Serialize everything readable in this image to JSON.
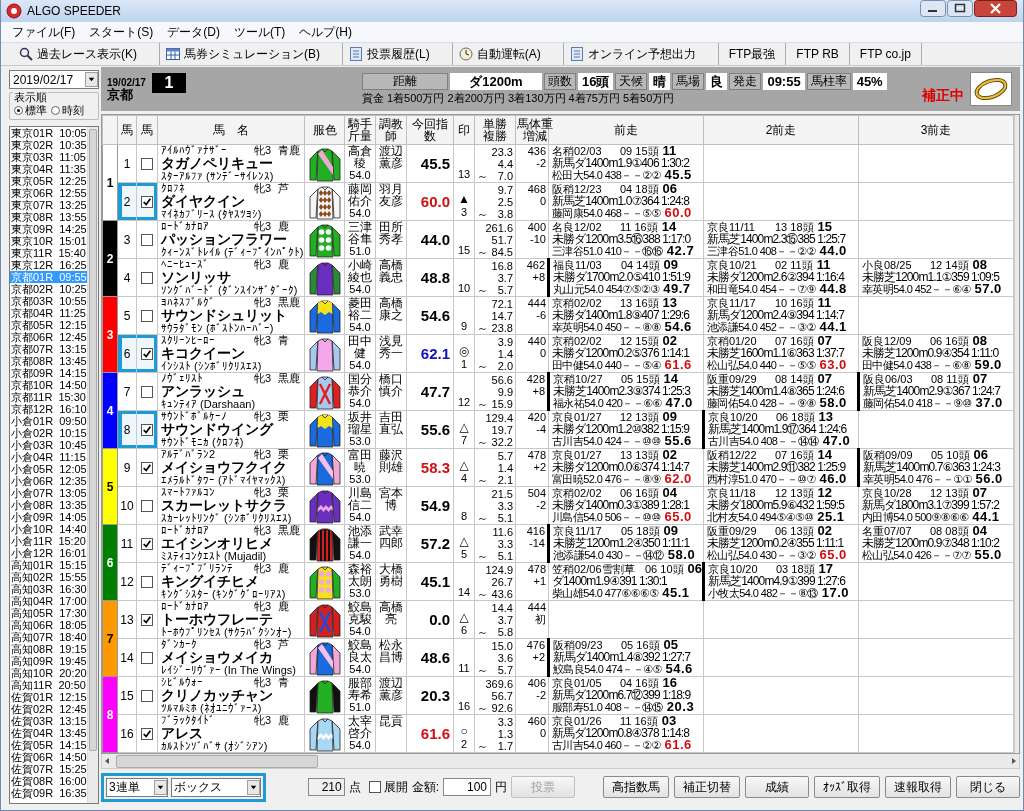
{
  "window": {
    "title": "ALGO SPEEDER"
  },
  "menu": [
    "ファイル(F)",
    "スタート(S)",
    "データ(D)",
    "ツール(T)",
    "ヘルプ(H)"
  ],
  "toolbar": [
    {
      "label": "過去レース表示(K)",
      "kind": "search"
    },
    {
      "label": "馬券シミュレーション(B)",
      "kind": "table"
    },
    {
      "label": "投票履歴(L)",
      "kind": "document"
    },
    {
      "label": "自動運転(A)",
      "kind": "clock"
    },
    {
      "label": "オンライン予想出力",
      "kind": "document"
    },
    {
      "label": "FTP最強",
      "kind": "text"
    },
    {
      "label": "FTP RB",
      "kind": "text"
    },
    {
      "label": "FTP co.jp",
      "kind": "text"
    }
  ],
  "sidebar": {
    "date": "2019/02/17",
    "sort_label": "表示順",
    "sort_options": [
      {
        "label": "標準",
        "selected": true
      },
      {
        "label": "時刻",
        "selected": false
      }
    ],
    "races": [
      {
        "race": "東京01R",
        "time": "10:05",
        "selected": false
      },
      {
        "race": "東京02R",
        "time": "10:35",
        "selected": false
      },
      {
        "race": "東京03R",
        "time": "11:05",
        "selected": false
      },
      {
        "race": "東京04R",
        "time": "11:35",
        "selected": false
      },
      {
        "race": "東京05R",
        "time": "12:25",
        "selected": false
      },
      {
        "race": "東京06R",
        "time": "12:55",
        "selected": false
      },
      {
        "race": "東京07R",
        "time": "13:25",
        "selected": false
      },
      {
        "race": "東京08R",
        "time": "13:55",
        "selected": false
      },
      {
        "race": "東京09R",
        "time": "14:25",
        "selected": false
      },
      {
        "race": "東京10R",
        "time": "15:01",
        "selected": false
      },
      {
        "race": "東京11R",
        "time": "15:40",
        "selected": false
      },
      {
        "race": "東京12R",
        "time": "16:25",
        "selected": false
      },
      {
        "race": "京都01R",
        "time": "09:55",
        "selected": true
      },
      {
        "race": "京都02R",
        "time": "10:25",
        "selected": false
      },
      {
        "race": "京都03R",
        "time": "10:55",
        "selected": false
      },
      {
        "race": "京都04R",
        "time": "11:25",
        "selected": false
      },
      {
        "race": "京都05R",
        "time": "12:15",
        "selected": false
      },
      {
        "race": "京都06R",
        "time": "12:45",
        "selected": false
      },
      {
        "race": "京都07R",
        "time": "13:15",
        "selected": false
      },
      {
        "race": "京都08R",
        "time": "13:45",
        "selected": false
      },
      {
        "race": "京都09R",
        "time": "14:15",
        "selected": false
      },
      {
        "race": "京都10R",
        "time": "14:50",
        "selected": false
      },
      {
        "race": "京都11R",
        "time": "15:30",
        "selected": false
      },
      {
        "race": "京都12R",
        "time": "16:10",
        "selected": false
      },
      {
        "race": "小倉01R",
        "time": "09:50",
        "selected": false
      },
      {
        "race": "小倉02R",
        "time": "10:15",
        "selected": false
      },
      {
        "race": "小倉03R",
        "time": "10:45",
        "selected": false
      },
      {
        "race": "小倉04R",
        "time": "11:15",
        "selected": false
      },
      {
        "race": "小倉05R",
        "time": "12:05",
        "selected": false
      },
      {
        "race": "小倉06R",
        "time": "12:35",
        "selected": false
      },
      {
        "race": "小倉07R",
        "time": "13:05",
        "selected": false
      },
      {
        "race": "小倉08R",
        "time": "13:35",
        "selected": false
      },
      {
        "race": "小倉09R",
        "time": "14:05",
        "selected": false
      },
      {
        "race": "小倉10R",
        "time": "14:40",
        "selected": false
      },
      {
        "race": "小倉11R",
        "time": "15:20",
        "selected": false
      },
      {
        "race": "小倉12R",
        "time": "16:01",
        "selected": false
      },
      {
        "race": "高知01R",
        "time": "15:15",
        "selected": false
      },
      {
        "race": "高知02R",
        "time": "15:55",
        "selected": false
      },
      {
        "race": "高知03R",
        "time": "16:30",
        "selected": false
      },
      {
        "race": "高知04R",
        "time": "17:00",
        "selected": false
      },
      {
        "race": "高知05R",
        "time": "17:30",
        "selected": false
      },
      {
        "race": "高知06R",
        "time": "18:05",
        "selected": false
      },
      {
        "race": "高知07R",
        "time": "18:40",
        "selected": false
      },
      {
        "race": "高知08R",
        "time": "19:15",
        "selected": false
      },
      {
        "race": "高知09R",
        "time": "19:45",
        "selected": false
      },
      {
        "race": "高知10R",
        "time": "20:20",
        "selected": false
      },
      {
        "race": "高知11R",
        "time": "20:50",
        "selected": false
      },
      {
        "race": "佐賀01R",
        "time": "12:15",
        "selected": false
      },
      {
        "race": "佐賀02R",
        "time": "12:45",
        "selected": false
      },
      {
        "race": "佐賀03R",
        "time": "13:15",
        "selected": false
      },
      {
        "race": "佐賀04R",
        "time": "13:45",
        "selected": false
      },
      {
        "race": "佐賀05R",
        "time": "14:15",
        "selected": false
      },
      {
        "race": "佐賀06R",
        "time": "14:50",
        "selected": false
      },
      {
        "race": "佐賀07R",
        "time": "15:25",
        "selected": false
      },
      {
        "race": "佐賀08R",
        "time": "16:00",
        "selected": false
      },
      {
        "race": "佐賀09R",
        "time": "16:35",
        "selected": false
      }
    ]
  },
  "race": {
    "date": "19/02/17",
    "venue": "京都",
    "number": "1",
    "info": [
      {
        "label": "距離",
        "value": "ダ1200m"
      },
      {
        "label": "頭数",
        "value": "16頭"
      },
      {
        "label": "天候",
        "value": "晴"
      },
      {
        "label": "馬場",
        "value": "良"
      },
      {
        "label": "発走",
        "value": "09:55"
      },
      {
        "label": "馬柱率",
        "value": "45%"
      }
    ],
    "prize": "賞金 1着500万円 2着200万円 3着130万円 4着75万円 5着50万円",
    "status": "補正中"
  },
  "table": {
    "columns": [
      "馬",
      "馬",
      "馬　名",
      "服色",
      "騎手斤量",
      "調教師",
      "今回指数",
      "印",
      "単勝複勝",
      "馬体重増減",
      "前走",
      "2前走",
      "3前走"
    ],
    "frames": [
      {
        "number": "1",
        "color": "#ffffff",
        "horses": [
          {
            "number": "1",
            "checked": false,
            "highlighted": false,
            "sire": "ｱｲﾙﾊｳﾞｧﾅｻﾞｰ",
            "sex_age": "牝3",
            "coat": "青鹿",
            "name": "タガノペリキュー",
            "dam": "ｽﾀｰｱﾙﾌｧ (ｻﾝﾃﾞｰｻｲﾚﾝｽ)",
            "silks": {
              "kind": "sash",
              "color": "#22b022",
              "sleeves": {
                "color": "#22b022"
              },
              "pattern": {
                "color": "#f0a8d8"
              }
            },
            "jockey": "高倉稜",
            "weight": "54.0",
            "trainer": "渡辺薫彦",
            "index": "45.5",
            "top_index": false,
            "high_index": false,
            "popularity": "13",
            "win": "23.3",
            "place_low": "4.4",
            "range_sign": "～",
            "place_high": "7.0",
            "body_weight": "436",
            "weight_change": "-2",
            "past": [
              {
                "date": "名稍02/03",
                "field": "09 15頭",
                "finish": "11",
                "detail": "新馬ダ1400m1.9①406 1:30:2",
                "jockey": "松田大54.0 438－－②②",
                "index": "45.5",
                "high_index": false,
                "flagged": false
              }
            ]
          },
          {
            "number": "2",
            "checked": true,
            "highlighted": true,
            "sire": "ｸﾛﾌﾈ",
            "sex_age": "牝3",
            "coat": "芦",
            "name": "ダイヤクイン",
            "dam": "ﾏｲﾈｶﾌﾞﾘｰｽ (ﾀﾔｽﾂﾖｼ)",
            "silks": {
              "kind": "diamonds",
              "color": "#f6f6f6",
              "sleeves": {
                "color": "#f6f6f6"
              },
              "pattern": {
                "color": "#8b4a1a"
              }
            },
            "jockey": "藤岡佑介",
            "weight": "54.0",
            "trainer": "羽月友彦",
            "index": "60.0",
            "top_index": false,
            "high_index": true,
            "mark": "▲",
            "popularity": "3",
            "win": "9.7",
            "place_low": "2.5",
            "range_sign": "～",
            "place_high": "3.8",
            "body_weight": "468",
            "weight_change": "0",
            "past": [
              {
                "date": "阪稍12/23",
                "field": "04 18頭",
                "finish": "06",
                "detail": "新馬芝1400m1.0⑦364 1:24:8",
                "jockey": "藤岡康54.0 468－－⑤⑤",
                "index": "60.0",
                "high_index": true,
                "flagged": false
              }
            ]
          }
        ]
      },
      {
        "number": "2",
        "color": "#000000",
        "horses": [
          {
            "number": "3",
            "checked": false,
            "highlighted": false,
            "sire": "ﾛｰﾄﾞｶﾅﾛｱ",
            "sex_age": "牝3",
            "coat": "鹿",
            "name": "パッションフラワー",
            "dam": "ｸｨｰﾝｽﾞﾄﾚｲﾙ (ﾃﾞｨｰﾌﾟｲﾝﾊﾟｸﾄ)",
            "silks": {
              "kind": "dots",
              "color": "#22b022",
              "sleeves": {
                "color": "#22b022"
              },
              "pattern": {
                "color": "#fafafa"
              }
            },
            "jockey": "三津谷隼",
            "weight": "51.0",
            "trainer": "田所秀孝",
            "index": "44.0",
            "top_index": false,
            "high_index": false,
            "popularity": "15",
            "win": "261.6",
            "place_low": "51.7",
            "range_sign": "～",
            "place_high": "84.5",
            "body_weight": "400",
            "weight_change": "-10",
            "past": [
              {
                "date": "名良12/02",
                "field": "11 16頭",
                "finish": "14",
                "detail": "未勝ダ1200m3.5⑯388 1:17:0",
                "jockey": "三津谷51.0 410－－⑯⑯",
                "index": "42.7",
                "high_index": false,
                "flagged": false
              },
              {
                "date": "京良11/11",
                "field": "13 18頭",
                "finish": "15",
                "detail": "新馬芝1400m2.3⑮385 1:25:7",
                "jockey": "三津谷51.0 408－－②②",
                "index": "44.0",
                "high_index": false,
                "flagged": false
              }
            ]
          },
          {
            "number": "4",
            "checked": false,
            "highlighted": false,
            "sire": "ﾍﾆｰﾋｭｰｽﾞ",
            "sex_age": "牝3",
            "coat": "鹿",
            "name": "ソンリッサ",
            "dam": "ｿﾝｸﾞﾊﾞｰﾄﾞ (ﾀﾞﾝｽｲﾝｻﾞﾀﾞｰｸ)",
            "silks": {
              "kind": "plain",
              "color": "#6a2fbf",
              "sleeves": {
                "color": "#2a8a3a"
              }
            },
            "jockey": "小崎綾也",
            "weight": "54.0",
            "trainer": "高橋義忠",
            "index": "48.8",
            "top_index": false,
            "high_index": false,
            "popularity": "10",
            "win": "16.8",
            "place_low": "3.7",
            "range_sign": "～",
            "place_high": "5.7",
            "body_weight": "462",
            "weight_change": "+8",
            "past": [
              {
                "date": "福良11/03",
                "field": "04 14頭",
                "finish": "09",
                "detail": "未勝ダ1700m2.0⑤410 1:51:9",
                "jockey": "丸山元54.0 454⑦⑤②③",
                "index": "49.7",
                "high_index": false,
                "flagged": true
              },
              {
                "date": "京良10/21",
                "field": "02 11頭",
                "finish": "11",
                "detail": "未勝ダ1200m2.6②394 1:16:4",
                "jockey": "和田竜54.0 454－－⑦⑨",
                "index": "44.8",
                "high_index": false,
                "flagged": false
              },
              {
                "date": "小良08/25",
                "field": "12 14頭",
                "finish": "08",
                "detail": "未勝芝1200m1.1①359 1:09:5",
                "jockey": "幸英明54.0 452－－⑥④",
                "index": "57.0",
                "high_index": false,
                "flagged": false
              }
            ]
          }
        ]
      },
      {
        "number": "3",
        "color": "#ff0000",
        "horses": [
          {
            "number": "5",
            "checked": false,
            "highlighted": false,
            "sire": "ﾖﾊﾈｽﾌﾞﾙｸﾞ",
            "sex_age": "牝3",
            "coat": "黒鹿",
            "name": "サウンドシュリット",
            "dam": "ｻｳﾗﾀﾞﾓﾝ (ﾎﾞｽﾄﾝﾊｰﾊﾞｰ)",
            "silks": {
              "kind": "halves",
              "color": "#1a6ae0",
              "sleeves": {
                "color": "#1a6ae0"
              },
              "pattern": {
                "color": "#f5e21a"
              }
            },
            "jockey": "菱田裕二",
            "weight": "54.0",
            "trainer": "高橋康之",
            "index": "54.6",
            "top_index": false,
            "high_index": false,
            "popularity": "9",
            "win": "72.1",
            "place_low": "14.7",
            "range_sign": "～",
            "place_high": "23.8",
            "body_weight": "444",
            "weight_change": "-6",
            "past": [
              {
                "date": "京稍02/02",
                "field": "13 16頭",
                "finish": "13",
                "detail": "未勝ダ1400m1.8⑨407 1:29:6",
                "jockey": "幸英明54.0 450－－⑧⑧",
                "index": "54.6",
                "high_index": false,
                "flagged": false
              },
              {
                "date": "京良11/17",
                "field": "10 16頭",
                "finish": "11",
                "detail": "新馬ダ1200m2.4⑨394 1:14:7",
                "jockey": "池添謙54.0 452－－③②",
                "index": "44.1",
                "high_index": false,
                "flagged": false
              }
            ]
          },
          {
            "number": "6",
            "checked": true,
            "highlighted": true,
            "sire": "ｽｸﾘｰﾝﾋｰﾛｰ",
            "sex_age": "牝3",
            "coat": "青",
            "name": "キコクイーン",
            "dam": "ｲﾝｼｽﾄ (ｼﾝﾎﾞﾘｸﾘｽｴｽ)",
            "silks": {
              "kind": "plain",
              "color": "#f4a8ec",
              "sleeves": {
                "color": "#a8c8f0"
              }
            },
            "jockey": "田中健",
            "weight": "54.0",
            "trainer": "浅見秀一",
            "index": "62.1",
            "top_index": true,
            "high_index": false,
            "mark": "◎",
            "popularity": "1",
            "win": "3.9",
            "place_low": "1.4",
            "range_sign": "～",
            "place_high": "2.0",
            "body_weight": "440",
            "weight_change": "0",
            "past": [
              {
                "date": "京稍02/02",
                "field": "12 15頭",
                "finish": "02",
                "detail": "未勝ダ1200m0.2⑤376 1:14:1",
                "jockey": "田中健54.0 440－－⑤④",
                "index": "61.6",
                "high_index": true,
                "flagged": false
              },
              {
                "date": "京稍01/20",
                "field": "07 16頭",
                "finish": "07",
                "detail": "未勝芝1600m1.1⑥363 1:37:7",
                "jockey": "松山弘54.0 440－－⑤⑤",
                "index": "63.0",
                "high_index": true,
                "flagged": false
              },
              {
                "date": "阪良12/09",
                "field": "06 16頭",
                "finish": "08",
                "detail": "未勝芝1200m0.9④354 1:11:0",
                "jockey": "田中健54.0 438－－⑥⑧",
                "index": "59.0",
                "high_index": false,
                "flagged": false
              }
            ]
          }
        ]
      },
      {
        "number": "4",
        "color": "#0000ff",
        "horses": [
          {
            "number": "7",
            "checked": false,
            "highlighted": false,
            "sire": "ﾉｳﾞｪﾘｽﾄ",
            "sex_age": "牝3",
            "coat": "黒鹿",
            "name": "アンラッシュ",
            "dam": "ｷｭﾝﾃｨｱ (Darshaan)",
            "silks": {
              "kind": "cross",
              "color": "#a8c8f0",
              "sleeves": {
                "color": "#e02020"
              },
              "pattern": {
                "color": "#e02020"
              }
            },
            "jockey": "国分恭介",
            "weight": "54.0",
            "trainer": "橋口慎介",
            "index": "47.7",
            "top_index": false,
            "high_index": false,
            "popularity": "12",
            "win": "56.6",
            "place_low": "9.9",
            "range_sign": "～",
            "place_high": "15.9",
            "body_weight": "428",
            "weight_change": "+8",
            "past": [
              {
                "date": "京稍10/27",
                "field": "05 15頭",
                "finish": "14",
                "detail": "未勝芝1400m2.3⑨374 1:25:3",
                "jockey": "福永祐54.0 420－－⑥⑥",
                "index": "47.0",
                "high_index": false,
                "flagged": true
              },
              {
                "date": "阪重09/29",
                "field": "08 14頭",
                "finish": "07",
                "detail": "未勝芝1400m1.4⑧365 1:24:6",
                "jockey": "藤岡佑54.0 428－－⑨⑧",
                "index": "58.0",
                "high_index": false,
                "flagged": false
              },
              {
                "date": "阪良06/03",
                "field": "08 11頭",
                "finish": "07",
                "detail": "新馬芝1400m2.9①367 1:24:7",
                "jockey": "藤岡佑54.0 418－－⑨⑩",
                "index": "37.0",
                "high_index": false,
                "flagged": true
              }
            ]
          },
          {
            "number": "8",
            "checked": true,
            "highlighted": true,
            "sire": "ｻｳﾝﾄﾞﾎﾞﾙｹｰﾉ",
            "sex_age": "牝3",
            "coat": "栗",
            "name": "サウンドウイング",
            "dam": "ｻｳﾝﾄﾞﾓﾆｶ (ｸﾛﾌﾈ)",
            "silks": {
              "kind": "halves",
              "color": "#1a6ae0",
              "sleeves": {
                "color": "#1a6ae0"
              },
              "pattern": {
                "color": "#f5e21a"
              }
            },
            "jockey": "坂井瑠星",
            "weight": "53.0",
            "trainer": "吉田直弘",
            "index": "55.6",
            "top_index": false,
            "high_index": false,
            "mark": "△",
            "popularity": "7",
            "win": "129.4",
            "place_low": "19.7",
            "range_sign": "～",
            "place_high": "32.2",
            "body_weight": "420",
            "weight_change": "-4",
            "past": [
              {
                "date": "京良01/27",
                "field": "12 13頭",
                "finish": "09",
                "detail": "未勝ダ1200m1.2⑩382 1:15:9",
                "jockey": "古川吉54.0 424－－⑩⑩",
                "index": "55.6",
                "high_index": false,
                "flagged": false
              },
              {
                "date": "京良10/20",
                "field": "06 18頭",
                "finish": "13",
                "detail": "新馬芝1400m1.9⑰364 1:24:6",
                "jockey": "古川吉54.0 408－－⑭⑭",
                "index": "47.0",
                "high_index": false,
                "flagged": true
              }
            ]
          }
        ]
      },
      {
        "number": "5",
        "color": "#ffff00",
        "horses": [
          {
            "number": "9",
            "checked": true,
            "highlighted": false,
            "sire": "ｱﾙﾃﾞﾊﾞﾗﾝ2",
            "sex_age": "牝3",
            "coat": "栗",
            "name": "メイショウフクイク",
            "dam": "ｴﾒﾗﾙﾄﾞﾀﾜｰ (ｱﾄﾞﾏｲﾔﾏｯｸｽ)",
            "silks": {
              "kind": "sash",
              "color": "#1a6ae0",
              "sleeves": {
                "color": "#f0a8d8"
              },
              "pattern": {
                "color": "#f8c0e4"
              }
            },
            "jockey": "富田暁",
            "weight": "53.0",
            "trainer": "藤沢則雄",
            "index": "58.3",
            "top_index": false,
            "high_index": true,
            "mark": "△",
            "popularity": "4",
            "win": "5.7",
            "place_low": "1.4",
            "range_sign": "～",
            "place_high": "2.1",
            "body_weight": "478",
            "weight_change": "+2",
            "past": [
              {
                "date": "京良01/27",
                "field": "13 13頭",
                "finish": "02",
                "detail": "未勝ダ1200m0.0⑥374 1:14:7",
                "jockey": "富田暁52.0 476－－⑧⑨",
                "index": "62.0",
                "high_index": true,
                "flagged": false
              },
              {
                "date": "阪稍12/22",
                "field": "07 16頭",
                "finish": "14",
                "detail": "未勝芝1400m2.9⑪382 1:25:9",
                "jockey": "西村淳51.0 470－－⑩⑦",
                "index": "46.0",
                "high_index": false,
                "flagged": false
              },
              {
                "date": "阪稍09/09",
                "field": "05 10頭",
                "finish": "06",
                "detail": "新馬芝1400m0.7⑥363 1:24:3",
                "jockey": "幸英明54.0 476－－①①",
                "index": "56.0",
                "high_index": false,
                "flagged": true
              }
            ]
          },
          {
            "number": "10",
            "checked": false,
            "highlighted": false,
            "sire": "ｽﾏｰﾄﾌｧﾙｺﾝ",
            "sex_age": "牝3",
            "coat": "栗",
            "name": "スカーレットサクラ",
            "dam": "ｽｶｰﾚｯﾄﾘﾝｸﾞ (ｼﾝﾎﾞﾘｸﾘｽｴｽ)",
            "silks": {
              "kind": "wave",
              "color": "#6a2fbf",
              "sleeves": {
                "color": "#6a2fbf"
              },
              "pattern": {
                "color": "#f0a8e8"
              }
            },
            "jockey": "川島信二",
            "weight": "54.0",
            "trainer": "宮本博",
            "index": "54.9",
            "top_index": false,
            "high_index": false,
            "popularity": "8",
            "win": "21.5",
            "place_low": "3.3",
            "range_sign": "～",
            "place_high": "5.1",
            "body_weight": "504",
            "weight_change": "-2",
            "past": [
              {
                "date": "京稍02/02",
                "field": "06 16頭",
                "finish": "04",
                "detail": "未勝ダ1400m0.3①389 1:28:1",
                "jockey": "川島信54.0 506－－⑩⑩",
                "index": "65.0",
                "high_index": true,
                "flagged": false
              },
              {
                "date": "京良11/18",
                "field": "12 13頭",
                "finish": "12",
                "detail": "未勝ダ1800m5.9⑥432 1:59:5",
                "jockey": "北村友54.0 494⑤④⑤⑩",
                "index": "25.1",
                "high_index": false,
                "flagged": false
              },
              {
                "date": "京良10/28",
                "field": "12 13頭",
                "finish": "07",
                "detail": "新馬ダ1800m3.1⑦399 1:57:2",
                "jockey": "内田博54.0 500⑨⑧⑥⑥",
                "index": "44.1",
                "high_index": false,
                "flagged": false
              }
            ]
          }
        ]
      },
      {
        "number": "6",
        "color": "#008000",
        "horses": [
          {
            "number": "11",
            "checked": true,
            "highlighted": false,
            "sire": "ﾛｰﾄﾞｶﾅﾛｱ",
            "sex_age": "牝3",
            "coat": "黒鹿",
            "name": "エイシンオリヒメ",
            "dam": "ﾐｽﾃｨｺﾝｸｴｽﾄ (Mujadil)",
            "silks": {
              "kind": "stripes",
              "color": "#d02020",
              "sleeves": {
                "color": "#111111"
              },
              "pattern": {
                "color": "#111111"
              }
            },
            "jockey": "池添謙一",
            "weight": "54.0",
            "trainer": "武幸四郎",
            "index": "57.2",
            "top_index": false,
            "high_index": false,
            "mark": "△",
            "popularity": "5",
            "win": "11.6",
            "place_low": "3.3",
            "range_sign": "～",
            "place_high": "5.1",
            "body_weight": "416",
            "weight_change": "-14",
            "past": [
              {
                "date": "京良11/17",
                "field": "05 18頭",
                "finish": "09",
                "detail": "未勝芝1200m1.2④350 1:11:1",
                "jockey": "池添謙54.0 430－－⑭⑫",
                "index": "58.0",
                "high_index": false,
                "flagged": true
              },
              {
                "date": "阪重09/29",
                "field": "06 13頭",
                "finish": "02",
                "detail": "未勝芝1200m0.2④355 1:11:1",
                "jockey": "松山弘54.0 430－－③②",
                "index": "65.0",
                "high_index": true,
                "flagged": false
              },
              {
                "date": "名重07/07",
                "field": "08 08頭",
                "finish": "04",
                "detail": "未勝芝1200m0.9⑦348 1:10:2",
                "jockey": "松山弘54.0 426－－⑦⑦",
                "index": "55.0",
                "high_index": false,
                "flagged": false
              }
            ]
          },
          {
            "number": "12",
            "checked": false,
            "highlighted": false,
            "sire": "ﾃﾞｨｰﾌﾟﾌﾞﾘﾗﾝﾃ",
            "sex_age": "牝3",
            "coat": "鹿",
            "name": "キングイチヒメ",
            "dam": "ｷﾝｸﾞｼｽﾀｰ (ｷﾝｸﾞｸﾞﾛｰﾘｱｽ)",
            "silks": {
              "kind": "dots",
              "color": "#f5e21a",
              "sleeves": {
                "color": "#22b022"
              },
              "pattern": {
                "color": "#f0a8d8"
              }
            },
            "jockey": "森裕太朗",
            "weight": "53.0",
            "trainer": "大橋勇樹",
            "index": "45.1",
            "top_index": false,
            "high_index": false,
            "popularity": "14",
            "win": "124.9",
            "place_low": "26.7",
            "range_sign": "～",
            "place_high": "43.6",
            "body_weight": "478",
            "weight_change": "+1",
            "past": [
              {
                "date": "笠稍02/06雪割草",
                "field": "06 10頭",
                "finish": "06",
                "detail": "ダ1400m1.9④391 1:30:1",
                "jockey": "柴山雄54.0 477⑥⑥⑥⑤",
                "index": "45.1",
                "high_index": false,
                "flagged": false
              },
              {
                "date": "京良10/20",
                "field": "03 18頭",
                "finish": "17",
                "detail": "新馬芝1400m4.9①399 1:27:6",
                "jockey": "小牧太54.0 482－－⑧⑬",
                "index": "17.0",
                "high_index": false,
                "flagged": true
              }
            ]
          }
        ]
      },
      {
        "number": "7",
        "color": "#ff9900",
        "horses": [
          {
            "number": "13",
            "checked": true,
            "highlighted": false,
            "sire": "ﾛｰﾄﾞｶﾅﾛｱ",
            "sex_age": "牝3",
            "coat": "鹿",
            "name": "トーホウフレーテ",
            "dam": "ﾄｰﾎｳﾌﾟﾘﾝｾｽ (ｻｸﾗﾊﾞｸｼﾝｵｰ)",
            "silks": {
              "kind": "cross",
              "color": "#d02020",
              "sleeves": {
                "color": "#d02020"
              },
              "pattern": {
                "color": "#1a4ae0"
              }
            },
            "jockey": "鮫島克駿",
            "weight": "54.0",
            "trainer": "高橋亮",
            "index": "0.0",
            "top_index": false,
            "high_index": false,
            "mark": "△",
            "popularity": "6",
            "win": "14.4",
            "place_low": "3.7",
            "range_sign": "～",
            "place_high": "5.8",
            "body_weight": "444",
            "weight_change": "初"
          },
          {
            "number": "14",
            "checked": false,
            "highlighted": false,
            "sire": "ﾀﾞﾝｶｰｸ",
            "sex_age": "牝3",
            "coat": "芦",
            "name": "メイショウメイカ",
            "dam": "ﾚｲｼﾞｰﾘｳﾞｧｰ (In The Wings)",
            "silks": {
              "kind": "sash",
              "color": "#1a6ae0",
              "sleeves": {
                "color": "#f0a8d8"
              },
              "pattern": {
                "color": "#f8c0e4"
              }
            },
            "jockey": "鮫島良太",
            "weight": "54.0",
            "trainer": "松永昌博",
            "index": "48.6",
            "top_index": false,
            "high_index": false,
            "popularity": "11",
            "win": "15.0",
            "place_low": "3.6",
            "range_sign": "～",
            "place_high": "5.7",
            "body_weight": "476",
            "weight_change": "+2",
            "past": [
              {
                "date": "阪稍09/23",
                "field": "05 16頭",
                "finish": "05",
                "detail": "新馬ダ1400m1.4⑧392 1:27:7",
                "jockey": "鮫島良54.0 474－－④⑤",
                "index": "54.6",
                "high_index": false,
                "flagged": true
              }
            ]
          }
        ]
      },
      {
        "number": "8",
        "color": "#ff00ff",
        "horses": [
          {
            "number": "15",
            "checked": false,
            "highlighted": false,
            "sire": "ｼﾋﾞﾙｳｫｰ",
            "sex_age": "牝3",
            "coat": "青",
            "name": "クリノカッチャン",
            "dam": "ﾂﾙﾏﾙﾐﾎ (ﾈｵﾕﾆｳﾞｧｰｽ)",
            "silks": {
              "kind": "plain",
              "color": "#22b022",
              "sleeves": {
                "color": "#111111"
              }
            },
            "jockey": "服部寿希",
            "weight": "51.0",
            "trainer": "渡辺薫彦",
            "index": "20.3",
            "top_index": false,
            "high_index": false,
            "popularity": "16",
            "win": "369.6",
            "place_low": "56.7",
            "range_sign": "～",
            "place_high": "92.6",
            "body_weight": "406",
            "weight_change": "-2",
            "past": [
              {
                "date": "京良01/05",
                "field": "04 16頭",
                "finish": "16",
                "detail": "新馬ダ1200m6.7⑫399 1:18:9",
                "jockey": "服部寿51.0 408－－⑭⑮",
                "index": "20.3",
                "high_index": false,
                "flagged": false
              }
            ]
          },
          {
            "number": "16",
            "checked": true,
            "highlighted": false,
            "sire": "ﾌﾞﾗｯｸﾀｲﾄﾞ",
            "sex_age": "牝3",
            "coat": "鹿",
            "name": "アレス",
            "dam": "ｶﾙｽﾄﾝｿﾞﾊﾞｻ (ｵｼﾞｼｱﾝ)",
            "silks": {
              "kind": "wave",
              "color": "#a8d8f4",
              "sleeves": {
                "color": "#a8d8f4"
              },
              "pattern": {
                "color": "#ffffff"
              }
            },
            "jockey": "太宰啓介",
            "weight": "54.0",
            "trainer": "昆貢",
            "index": "61.6",
            "top_index": false,
            "high_index": true,
            "mark": "○",
            "popularity": "2",
            "win": "3.3",
            "place_low": "1.3",
            "range_sign": "～",
            "place_high": "1.7",
            "body_weight": "460",
            "weight_change": "0",
            "past": [
              {
                "date": "京良01/26",
                "field": "11 16頭",
                "finish": "03",
                "detail": "新馬ダ1200m0.8④378 1:14:8",
                "jockey": "古川吉54.0 460－－②②",
                "index": "61.6",
                "high_index": true,
                "flagged": false
              }
            ]
          }
        ]
      }
    ]
  },
  "footer": {
    "highlighted": true,
    "bet_type": "3連単",
    "bet_method": "ボックス",
    "points": "210",
    "points_unit": "点",
    "expand": {
      "label": "展開",
      "checked": false
    },
    "amount_label": "金額:",
    "amount": "100",
    "amount_unit": "円",
    "vote": {
      "label": "投票",
      "disabled": true
    },
    "buttons": [
      "高指数馬",
      "補正切替",
      "成績",
      "ｵｯｽﾞ取得",
      "速報取得",
      "閉じる"
    ]
  }
}
